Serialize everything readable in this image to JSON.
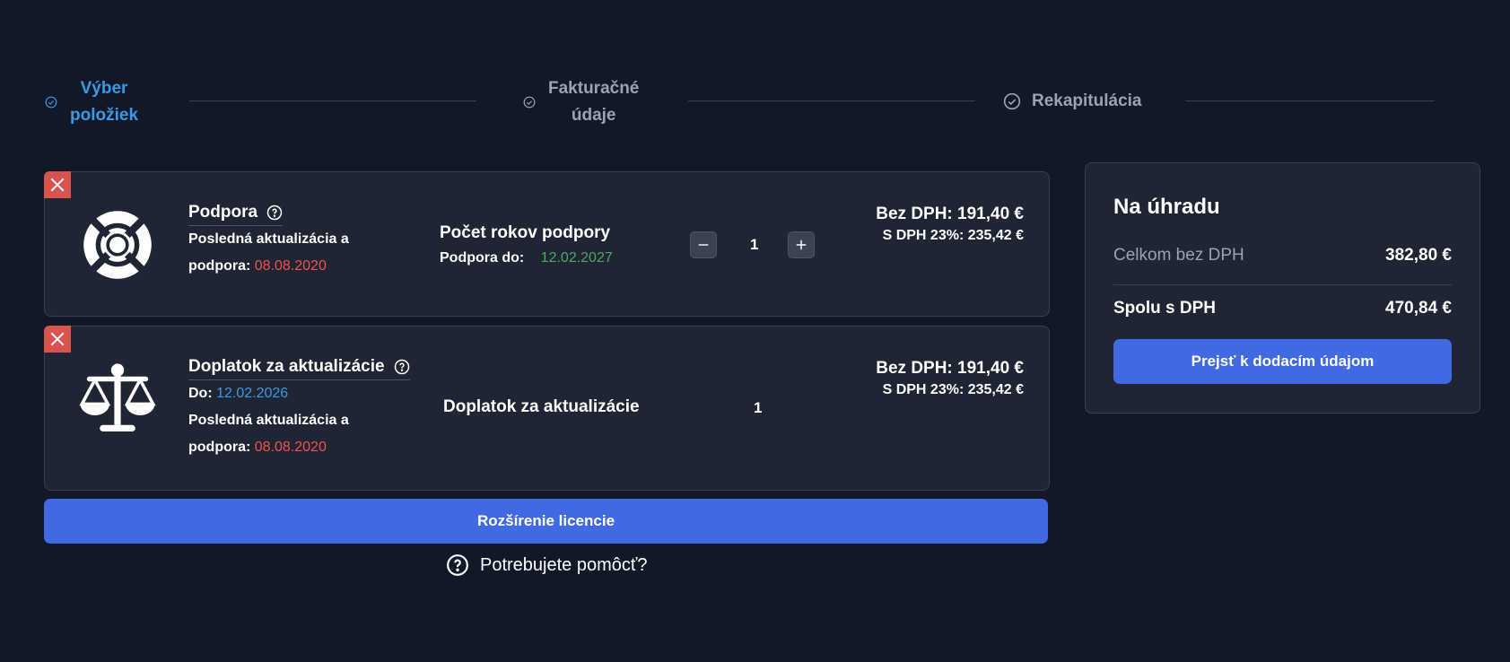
{
  "steps": [
    {
      "line1": "Výber",
      "line2": "položiek",
      "state": "active"
    },
    {
      "line1": "Fakturačné",
      "line2": "údaje",
      "state": "inactive"
    },
    {
      "line1": "Rekapitulácia",
      "line2": "",
      "state": "inactive"
    }
  ],
  "items": [
    {
      "name": "Podpora",
      "update_label": "Posledná aktualizácia a",
      "support_label": "podpora: ",
      "support_date": "08.08.2020",
      "mid_title": "Počet rokov podpory",
      "mid_sub_label": "Podpora do:",
      "mid_sub_value": "12.02.2027",
      "quantity": "1",
      "price_net": "Bez DPH: 191,40 €",
      "price_gross": "S DPH 23%: 235,42 €"
    },
    {
      "name": "Doplatok za aktualizácie",
      "to_label": "Do: ",
      "to_date": "12.02.2026",
      "update_label": "Posledná aktualizácia a",
      "support_label": "podpora: ",
      "support_date": "08.08.2020",
      "mid_title": "Doplatok za aktualizácie",
      "quantity": "1",
      "price_net": "Bez DPH: 191,40 €",
      "price_gross": "S DPH 23%: 235,42 €"
    }
  ],
  "extend_button": "Rozšírenie licencie",
  "help_text": "Potrebujete pomôcť?",
  "summary": {
    "title": "Na úhradu",
    "net_label": "Celkom bez DPH",
    "net_value": "382,80 €",
    "gross_label": "Spolu s DPH",
    "gross_value": "470,84 €",
    "button": "Prejsť k dodacím údajom"
  },
  "colors": {
    "background": "#111827",
    "card": "#1f2533",
    "accent": "#4169e1",
    "active_step": "#3b9ae6",
    "danger": "#d9534f",
    "date_red": "#ef5350",
    "date_green": "#4ea866"
  },
  "icons": [
    "check-circle-icon",
    "close-icon",
    "lifebuoy-icon",
    "scales-icon",
    "question-circle-icon",
    "minus-icon",
    "plus-icon"
  ]
}
